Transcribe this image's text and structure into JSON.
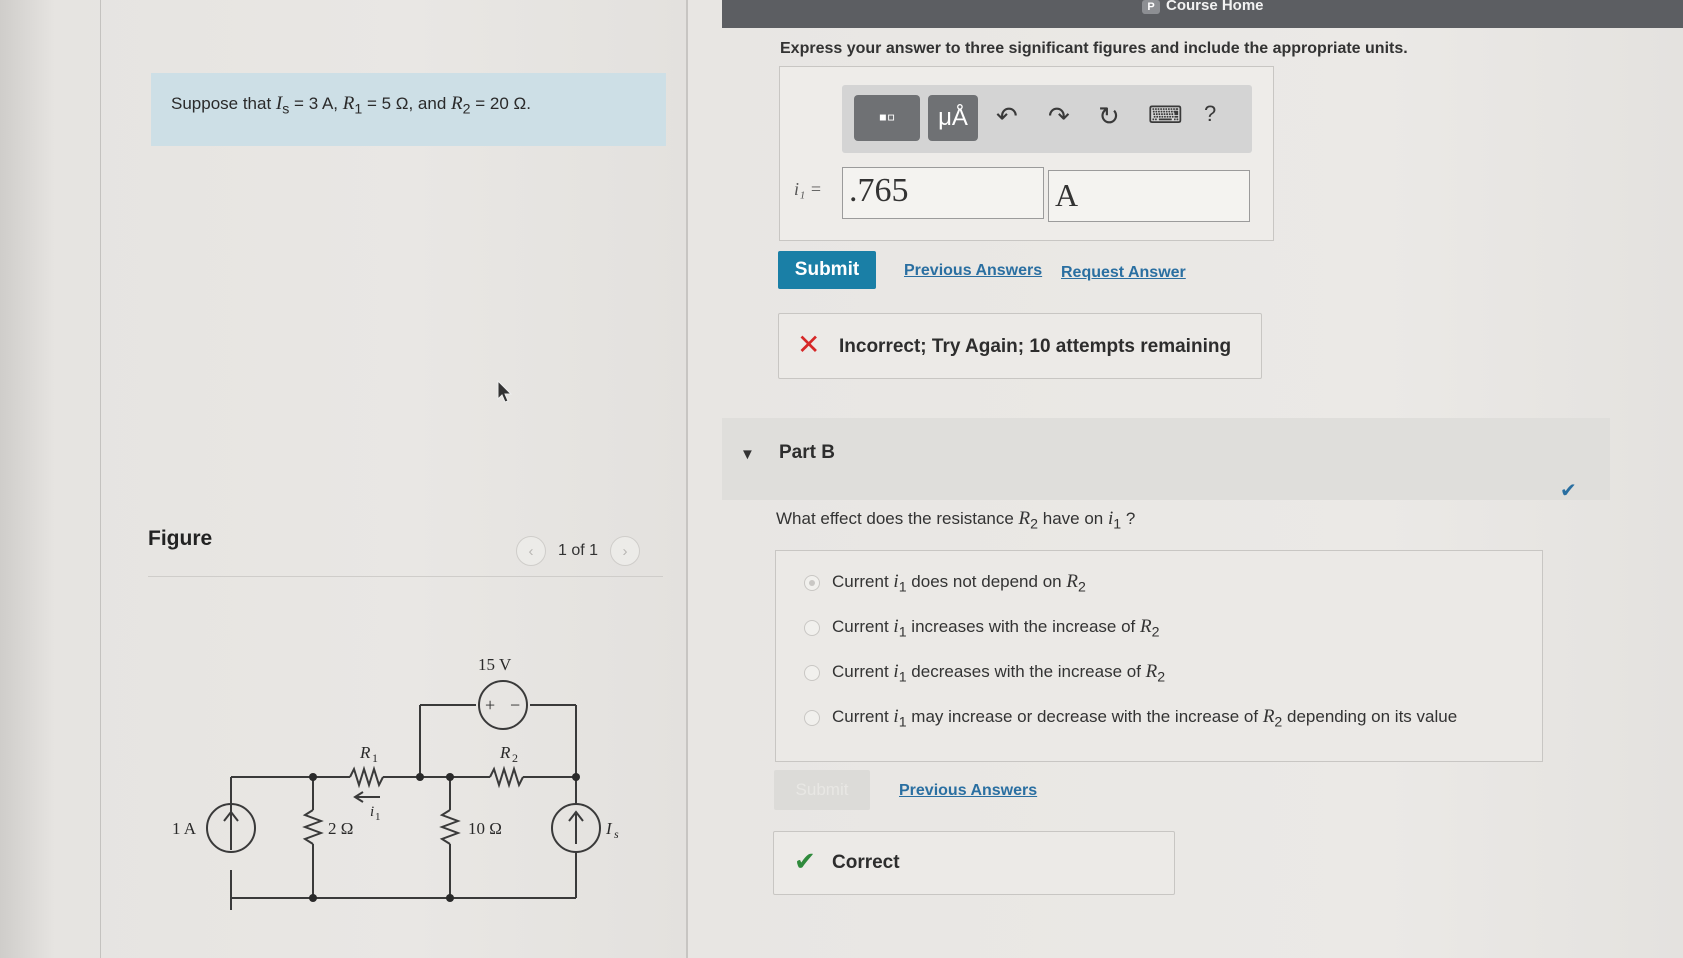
{
  "header": {
    "logo_letter": "P",
    "course_home": "Course Home"
  },
  "problem": {
    "prefix": "Suppose that ",
    "is_sym": "I",
    "is_sub": "s",
    "is_val": " = 3 A, ",
    "r1_sym": "R",
    "r1_sub": "1",
    "r1_val": " = 5 Ω, and ",
    "r2_sym": "R",
    "r2_sub": "2",
    "r2_val": " = 20 Ω."
  },
  "figure": {
    "label": "Figure",
    "pager": "1 of 1",
    "prev_icon": "‹",
    "next_icon": "›",
    "labels": {
      "v_source": "15 V",
      "r1": "R",
      "r1_sub": "1",
      "r2": "R",
      "r2_sub": "2",
      "i1": "i",
      "i1_sub": "1",
      "src_1a": "1 A",
      "res_2": "2 Ω",
      "res_10": "10 Ω",
      "is": "I",
      "is_sub": "s",
      "plus": "+",
      "minus": "−"
    }
  },
  "part_a": {
    "instructions": "Express your answer to three significant figures and include the appropriate units.",
    "toolbar": {
      "templates_icon": "▪▫",
      "units_label": "μÅ",
      "undo_icon": "↶",
      "redo_icon": "↷",
      "reset_icon": "↻",
      "keyboard_icon": "⌨",
      "help_label": "?"
    },
    "answer_label": "i₁ =",
    "answer_value": ".765",
    "answer_unit": "A",
    "submit_label": "Submit",
    "previous_answers": "Previous Answers",
    "request_answer": "Request Answer",
    "feedback_icon": "✕",
    "feedback": "Incorrect; Try Again; 10 attempts remaining"
  },
  "part_b": {
    "toggle_icon": "▼",
    "title": "Part B",
    "status_icon": "✔",
    "question_prefix": "What effect does the resistance ",
    "question_r": "R",
    "question_r_sub": "2",
    "question_mid": " have on ",
    "question_i": "i",
    "question_i_sub": "1",
    "question_suffix": " ?",
    "options": [
      {
        "pre": "Current ",
        "sym": "i",
        "sub": "1",
        "post": " does not depend on ",
        "r": "R",
        "rsub": "2",
        "tail": ""
      },
      {
        "pre": "Current ",
        "sym": "i",
        "sub": "1",
        "post": " increases with the increase of ",
        "r": "R",
        "rsub": "2",
        "tail": ""
      },
      {
        "pre": "Current ",
        "sym": "i",
        "sub": "1",
        "post": " decreases with the increase of ",
        "r": "R",
        "rsub": "2",
        "tail": ""
      },
      {
        "pre": "Current ",
        "sym": "i",
        "sub": "1",
        "post": " may increase or decrease with the increase of ",
        "r": "R",
        "rsub": "2",
        "tail": " depending on its value"
      }
    ],
    "submit_label": "Submit",
    "previous_answers": "Previous Answers",
    "feedback_icon": "✔",
    "feedback": "Correct"
  }
}
